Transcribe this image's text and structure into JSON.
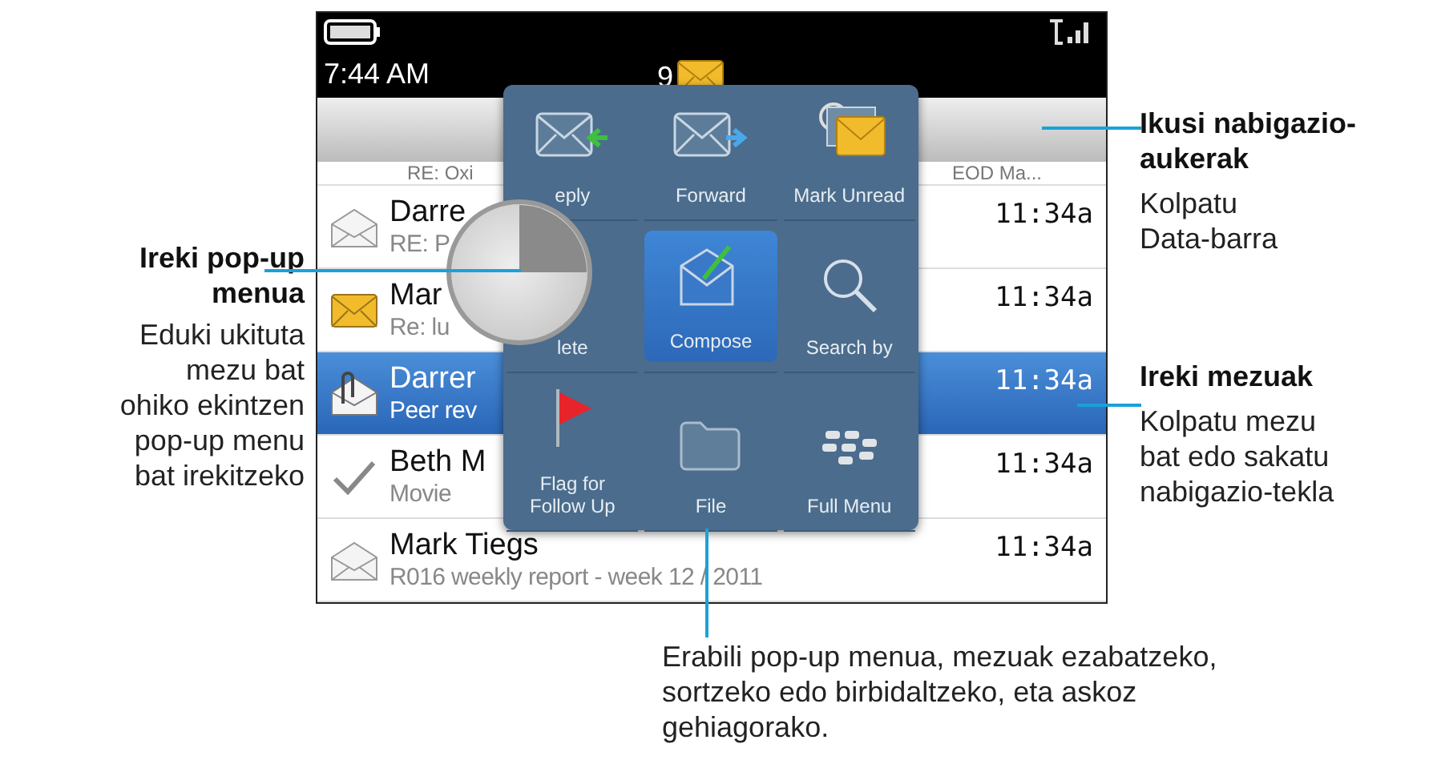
{
  "annotations": {
    "left": {
      "title": "Ireki pop-up\nmenua",
      "body": "Eduki ukituta\nmezu bat\nohiko ekintzen\npop-up menu\nbat irekitzeko"
    },
    "right": [
      {
        "title": "Ikusi nabigazio-\naukerak",
        "body": "Kolpatu\nData-barra"
      },
      {
        "title": "Ireki mezuak",
        "body": "Kolpatu mezu\nbat edo sakatu\nnabigazio-tekla"
      }
    ],
    "bottom": {
      "body": "Erabili pop-up menua, mezuak ezabatzeko,\nsortzeko edo birbidaltzeko, eta askoz\ngehiagorako."
    }
  },
  "status_bar": {
    "time": "7:44 AM",
    "unread_count": "9"
  },
  "partial_row": {
    "subject": "RE: Oxi",
    "trailing": "EOD Ma..."
  },
  "messages": [
    {
      "kind": "read",
      "sender": "Darre",
      "subject": "RE: P",
      "time": "11:34a",
      "selected": false
    },
    {
      "kind": "unread",
      "sender": "Mar",
      "subject": "Re: lu",
      "time": "11:34a",
      "selected": false
    },
    {
      "kind": "attachment",
      "sender": "Darrer",
      "subject": "Peer rev",
      "time": "11:34a",
      "selected": true
    },
    {
      "kind": "sent",
      "sender": "Beth M",
      "subject": "Movie",
      "time": "11:34a",
      "selected": false
    },
    {
      "kind": "read",
      "sender": "Mark Tiegs",
      "subject": "R016 weekly report - week 12 / 2011",
      "time": "11:34a",
      "selected": false
    }
  ],
  "popup_menu": {
    "items": [
      {
        "kind": "reply",
        "label": "eply",
        "selected": false
      },
      {
        "kind": "forward",
        "label": "Forward",
        "selected": false
      },
      {
        "kind": "mark-unread",
        "label": "Mark Unread",
        "selected": false
      },
      {
        "label": "lete",
        "selected": false
      },
      {
        "kind": "compose",
        "label": "Compose",
        "selected": true
      },
      {
        "kind": "search",
        "label": "Search by",
        "selected": false
      },
      {
        "kind": "flag",
        "label": "Flag for\nFollow Up",
        "selected": false
      },
      {
        "kind": "file",
        "label": "File",
        "selected": false
      },
      {
        "kind": "full-menu",
        "label": "Full Menu",
        "selected": false
      }
    ]
  }
}
